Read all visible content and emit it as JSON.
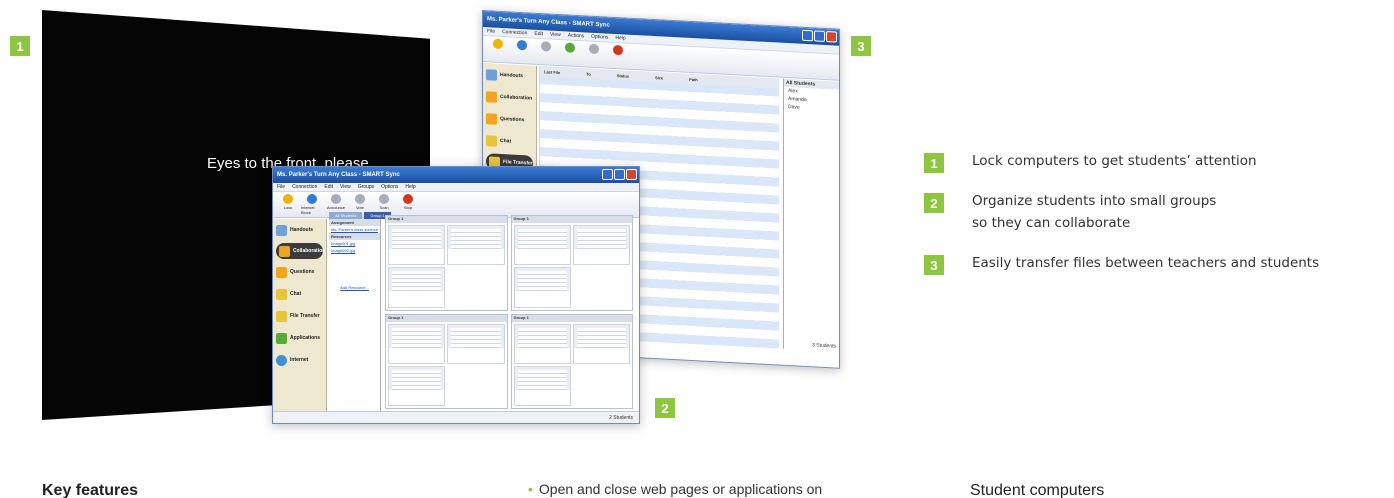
{
  "colors": {
    "accent_green": "#8dc63f",
    "window_blue": "#1b4f9e",
    "sidebar_beige": "#ede8cf"
  },
  "badges": {
    "one": "1",
    "two": "2",
    "three": "3"
  },
  "lock_screen": {
    "message": "Eyes to the front, please."
  },
  "collab_window": {
    "title": "Ms. Parker's Turn Any Class - SMART Sync",
    "menu": [
      "File",
      "Connection",
      "Edit",
      "View",
      "Groups",
      "Options",
      "Help"
    ],
    "toolbar": [
      "Lock",
      "Internet Block",
      "Announce",
      "Vote",
      "Scan",
      "Stop"
    ],
    "sidebar": [
      "Handouts",
      "Collaboration",
      "Questions",
      "Chat",
      "File Transfer",
      "Applications",
      "Internet"
    ],
    "tabs": [
      "All Students",
      "Group 1"
    ],
    "assignment_header": "Assignment",
    "assignment_link": "Ms. Parker's class science",
    "resources_header": "Resources",
    "resource_links": [
      "Image001.jpg",
      "Image002.jpg"
    ],
    "add_resource": "Add Resource...",
    "group_label": "Group 1",
    "status": "2 Students"
  },
  "transfer_window": {
    "title": "Ms. Parker's Turn Any Class - SMART Sync",
    "menu": [
      "File",
      "Connection",
      "Edit",
      "View",
      "Actions",
      "Options",
      "Help"
    ],
    "columns": [
      "Last File",
      "To",
      "Status",
      "Size",
      "Path"
    ],
    "students_title": "All Students",
    "students": [
      "Alex",
      "Amanda",
      "Dave"
    ],
    "status": "3 Students"
  },
  "legend": [
    {
      "number": "1",
      "text": "Lock computers to get students’ attention"
    },
    {
      "number": "2",
      "text": "Organize students into small groups so they can collaborate"
    },
    {
      "number": "3",
      "text": "Easily transfer files between teachers and students"
    }
  ],
  "bottom": {
    "key_features": "Key features",
    "bullet": "Open and close web pages or applications on",
    "student_computers": "Student computers"
  }
}
